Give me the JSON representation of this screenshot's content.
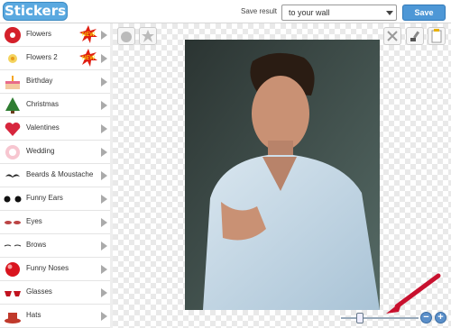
{
  "header": {
    "logo_text": "Stickers",
    "save_result_label": "Save result",
    "destination_select": "to your wall",
    "save_button": "Save"
  },
  "sidebar": {
    "items": [
      {
        "label": "Flowers",
        "icon": "flower-icon",
        "badge": "NEW"
      },
      {
        "label": "Flowers 2",
        "icon": "flower2-icon",
        "badge": "NEW"
      },
      {
        "label": "Birthday",
        "icon": "cake-icon"
      },
      {
        "label": "Christmas",
        "icon": "tree-icon"
      },
      {
        "label": "Valentines",
        "icon": "heart-icon"
      },
      {
        "label": "Wedding",
        "icon": "wedding-icon"
      },
      {
        "label": "Beards & Moustache",
        "icon": "moustache-icon"
      },
      {
        "label": "Funny Ears",
        "icon": "ears-icon"
      },
      {
        "label": "Eyes",
        "icon": "eyes-icon"
      },
      {
        "label": "Brows",
        "icon": "brows-icon"
      },
      {
        "label": "Funny Noses",
        "icon": "nose-icon"
      },
      {
        "label": "Glasses",
        "icon": "glasses-icon"
      },
      {
        "label": "Hats",
        "icon": "hat-icon"
      }
    ]
  },
  "toolbar": {
    "left_tools": [
      "sticker-tool-icon",
      "star-tool-icon"
    ],
    "right_tools": [
      "delete-icon",
      "brush-icon",
      "paste-icon"
    ]
  },
  "zoom": {
    "level": 0.2
  },
  "colors": {
    "accent": "#4d97d6",
    "arrow": "#c8102e"
  }
}
